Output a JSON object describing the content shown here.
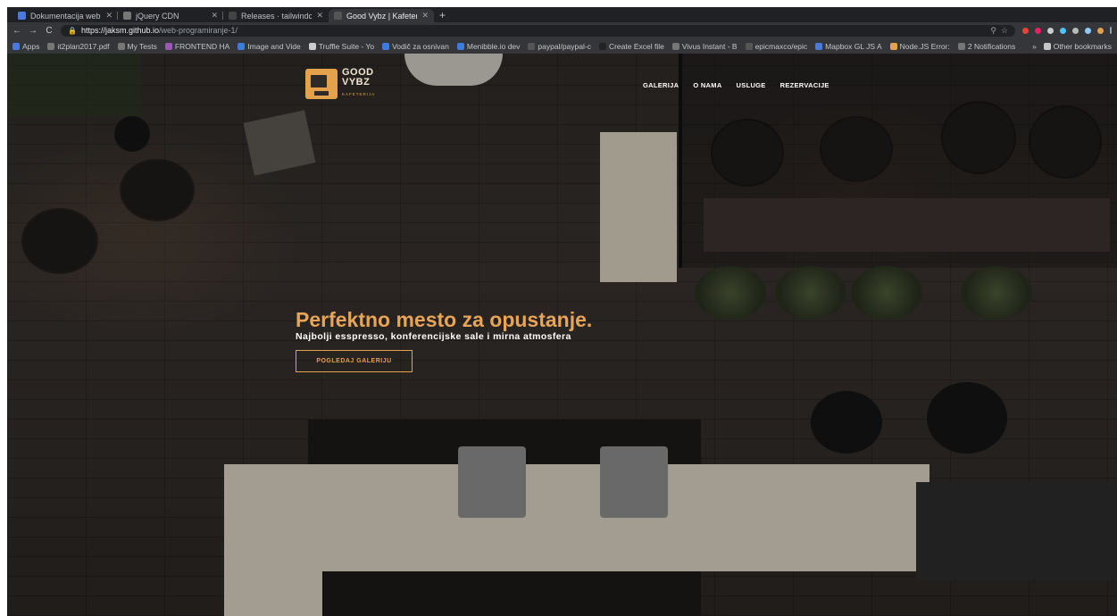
{
  "browser": {
    "tabs": [
      {
        "title": "Dokumentacija web proj",
        "favicon_color": "#4a7bdb",
        "active": false
      },
      {
        "title": "jQuery CDN",
        "favicon_color": "#777777",
        "active": false
      },
      {
        "title": "Releases · tailwindcss/tai",
        "favicon_color": "#444444",
        "active": false
      },
      {
        "title": "Good Vybz | Kafeterija",
        "favicon_color": "#555555",
        "active": true
      }
    ],
    "new_tab_symbol": "+",
    "address": {
      "host": "https://jaksm.github.io",
      "path": "/web-programiranje-1/"
    },
    "bookmarks": [
      {
        "label": "Apps",
        "color": "#4a7bdb"
      },
      {
        "label": "it2plan2017.pdf",
        "color": "#777777"
      },
      {
        "label": "My Tests",
        "color": "#777777"
      },
      {
        "label": "FRONTEND HA",
        "color": "#9b59b6"
      },
      {
        "label": "Image and Vide",
        "color": "#3d7be0"
      },
      {
        "label": "Truffle Suite - Yo",
        "color": "#cccccc"
      },
      {
        "label": "Vodič za osnivan",
        "color": "#3d7be0"
      },
      {
        "label": "Menibble.io dev",
        "color": "#3d7be0"
      },
      {
        "label": "paypal/paypal-c",
        "color": "#555555"
      },
      {
        "label": "Create Excel file",
        "color": "#222222"
      },
      {
        "label": "Vivus Instant - B",
        "color": "#777777"
      },
      {
        "label": "epicmaxco/epic",
        "color": "#555555"
      },
      {
        "label": "Mapbox GL JS A",
        "color": "#4a7bdb"
      },
      {
        "label": "Node.JS Error: ",
        "color": "#e3a24b"
      },
      {
        "label": "2 Notifications",
        "color": "#777777"
      }
    ],
    "other_bookmarks": "Other bookmarks"
  },
  "site": {
    "logo": {
      "line1": "GOOD",
      "line2": "VYBZ",
      "line3": "KAFETERIJA"
    },
    "nav": [
      "GALERIJA",
      "O NAMA",
      "USLUGE",
      "REZERVACIJE"
    ],
    "hero": {
      "title": "Perfektno mesto za opustanje.",
      "subtitle": "Najbolji esspresso, konferencijske sale i mirna atmosfera",
      "button": "POGLEDAJ GALERIJU"
    }
  },
  "colors": {
    "accent": "#e3a24b",
    "title": "#e8a457"
  }
}
